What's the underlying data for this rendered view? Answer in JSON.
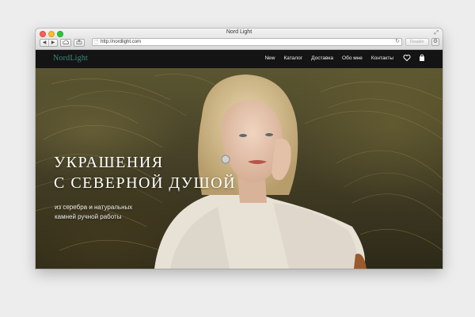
{
  "browser": {
    "window_title": "Nord Light",
    "url": "http://nordlight.com",
    "reader_label": "Reader",
    "nav_back_icon": "◀",
    "nav_forward_icon": "▶"
  },
  "site": {
    "logo": "NordLight",
    "menu": [
      "New",
      "Каталог",
      "Доставка",
      "Обо мне",
      "Контакты"
    ],
    "icons": [
      "heart-icon",
      "bag-icon"
    ]
  },
  "hero": {
    "title_line1": "УКРАШЕНИЯ",
    "title_line2": "С СЕВЕРНОЙ ДУШОЙ",
    "subtitle_line1": "из серебра и натуральных",
    "subtitle_line2": "камней ручной работы"
  },
  "colors": {
    "logo": "#3a8a7e",
    "nav_bg": "#141414",
    "hero_text": "#ffffff"
  }
}
